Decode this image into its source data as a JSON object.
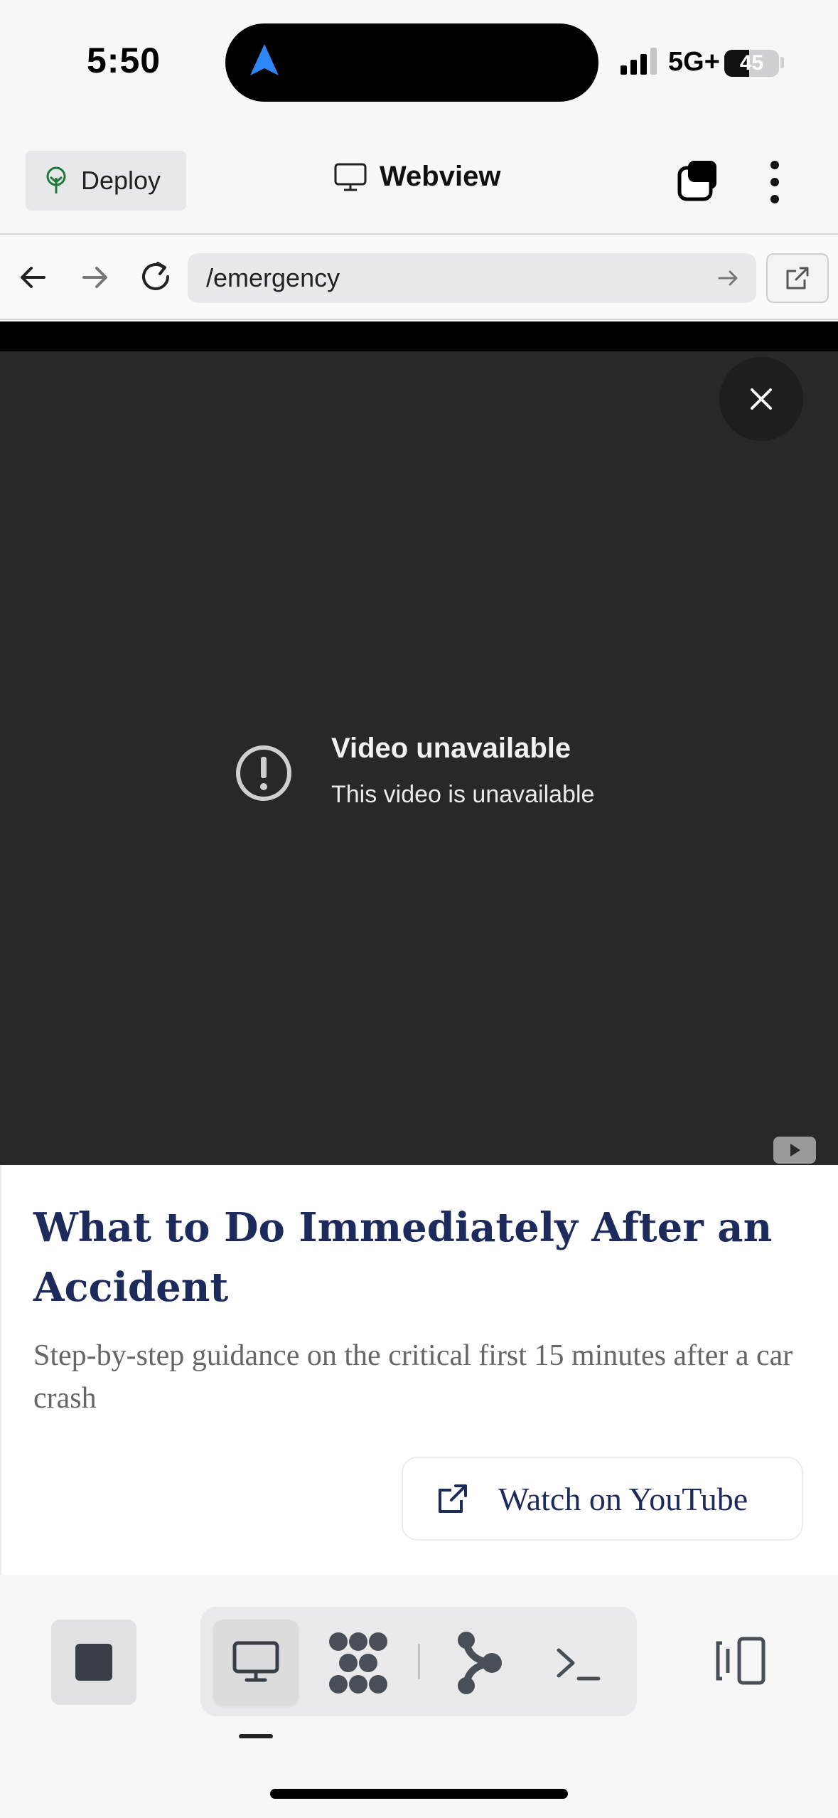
{
  "status_bar": {
    "time": "5:50",
    "network": "5G+",
    "battery": "45",
    "battery_level_percent": 45,
    "signal_bars": 3,
    "icons": [
      "navigation-arrow-icon",
      "signal-icon",
      "battery-icon"
    ]
  },
  "header": {
    "deploy_label": "Deploy",
    "title": "Webview",
    "icons": [
      "deploy-tree-icon",
      "monitor-icon",
      "tabs-icon",
      "more-vertical-icon"
    ]
  },
  "url_bar": {
    "url": "/emergency",
    "icons": [
      "back-arrow-icon",
      "forward-arrow-icon",
      "reload-icon",
      "go-arrow-icon",
      "open-external-icon"
    ]
  },
  "video": {
    "error_title": "Video unavailable",
    "error_message": "This video is unavailable",
    "icons": [
      "close-icon",
      "alert-circle-icon",
      "youtube-logo-icon"
    ]
  },
  "article": {
    "title": "What to Do Immediately After an Accident",
    "subtitle": "Step-by-step guidance on the critical first 15 minutes after a car crash",
    "watch_button_label": "Watch on YouTube"
  },
  "bottom_toolbar": {
    "items": [
      "stop-icon",
      "webview-monitor-icon",
      "workflow-icon",
      "git-icon",
      "shell-icon",
      "split-view-icon"
    ],
    "active_item": "webview-monitor-icon"
  },
  "colors": {
    "accent_navy": "#1c2a5c",
    "video_background": "#282828",
    "nav_arrow_blue": "#2f86f6"
  }
}
